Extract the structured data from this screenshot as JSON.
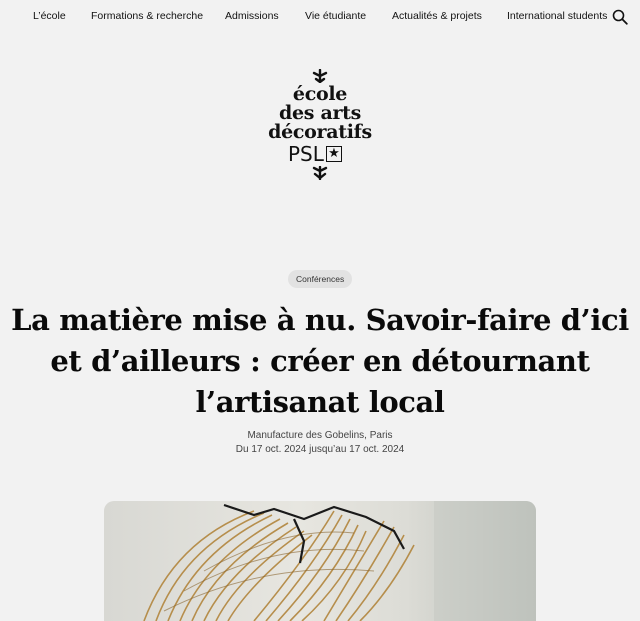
{
  "nav": {
    "items": [
      {
        "label": "L’école"
      },
      {
        "label": "Formations & recherche"
      },
      {
        "label": "Admissions"
      },
      {
        "label": "Vie étudiante"
      },
      {
        "label": "Actualités & projets"
      },
      {
        "label": "International students"
      }
    ],
    "search_icon": "search-icon"
  },
  "logo": {
    "lines": [
      "école",
      "des arts",
      "décoratifs"
    ],
    "psl": "PSL",
    "star": "★"
  },
  "event": {
    "category": "Conférences",
    "title": "La matière mise à nu. Savoir-faire d’ici et d’ailleurs : créer en détournant l’artisanat local",
    "location": "Manufacture des Gobelins, Paris",
    "dates": "Du 17 oct. 2024 jusqu’au 17 oct. 2024"
  },
  "hero_image": {
    "icon": "woven-rattan-sculpture-image"
  }
}
